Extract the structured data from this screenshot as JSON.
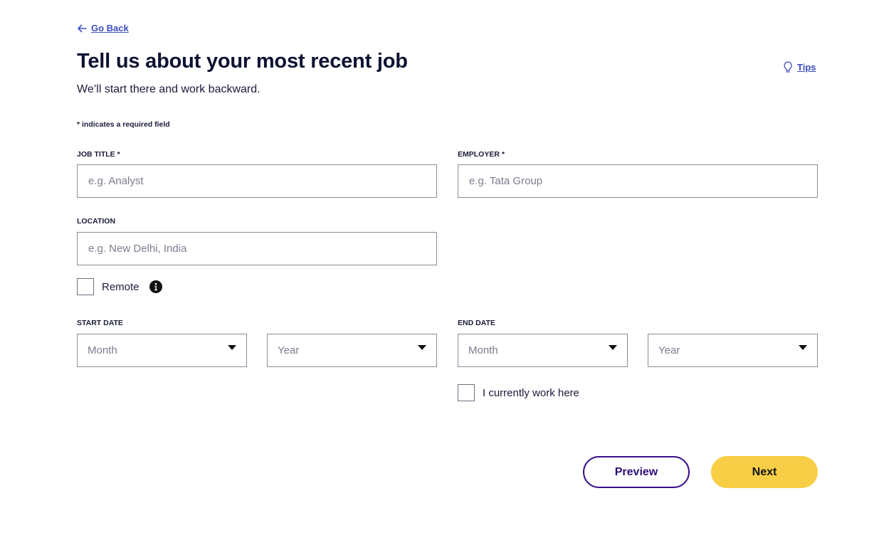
{
  "nav": {
    "go_back": "Go Back",
    "tips": "Tips"
  },
  "header": {
    "title": "Tell us about your most recent job",
    "subtitle": "We’ll start there and work backward."
  },
  "form": {
    "required_note": "* indicates a required field",
    "job_title": {
      "label": "JOB TITLE *",
      "placeholder": "e.g. Analyst",
      "value": ""
    },
    "employer": {
      "label": "EMPLOYER *",
      "placeholder": "e.g. Tata Group",
      "value": ""
    },
    "location": {
      "label": "LOCATION",
      "placeholder": "e.g. New Delhi, India",
      "value": ""
    },
    "remote": {
      "label": "Remote",
      "checked": false
    },
    "start_date": {
      "label": "START DATE",
      "month": "Month",
      "year": "Year"
    },
    "end_date": {
      "label": "END DATE",
      "month": "Month",
      "year": "Year"
    },
    "currently_work": {
      "label": "I currently work here",
      "checked": false
    }
  },
  "actions": {
    "preview": "Preview",
    "next": "Next"
  },
  "colors": {
    "link": "#3b4cc0",
    "title": "#0e1232",
    "preview_border": "#3a0f8a",
    "next_bg": "#f7ce46",
    "input_border": "#8a8c9a"
  },
  "icons": [
    "arrow-left-icon",
    "lightbulb-icon",
    "info-icon",
    "chevron-down-icon"
  ]
}
